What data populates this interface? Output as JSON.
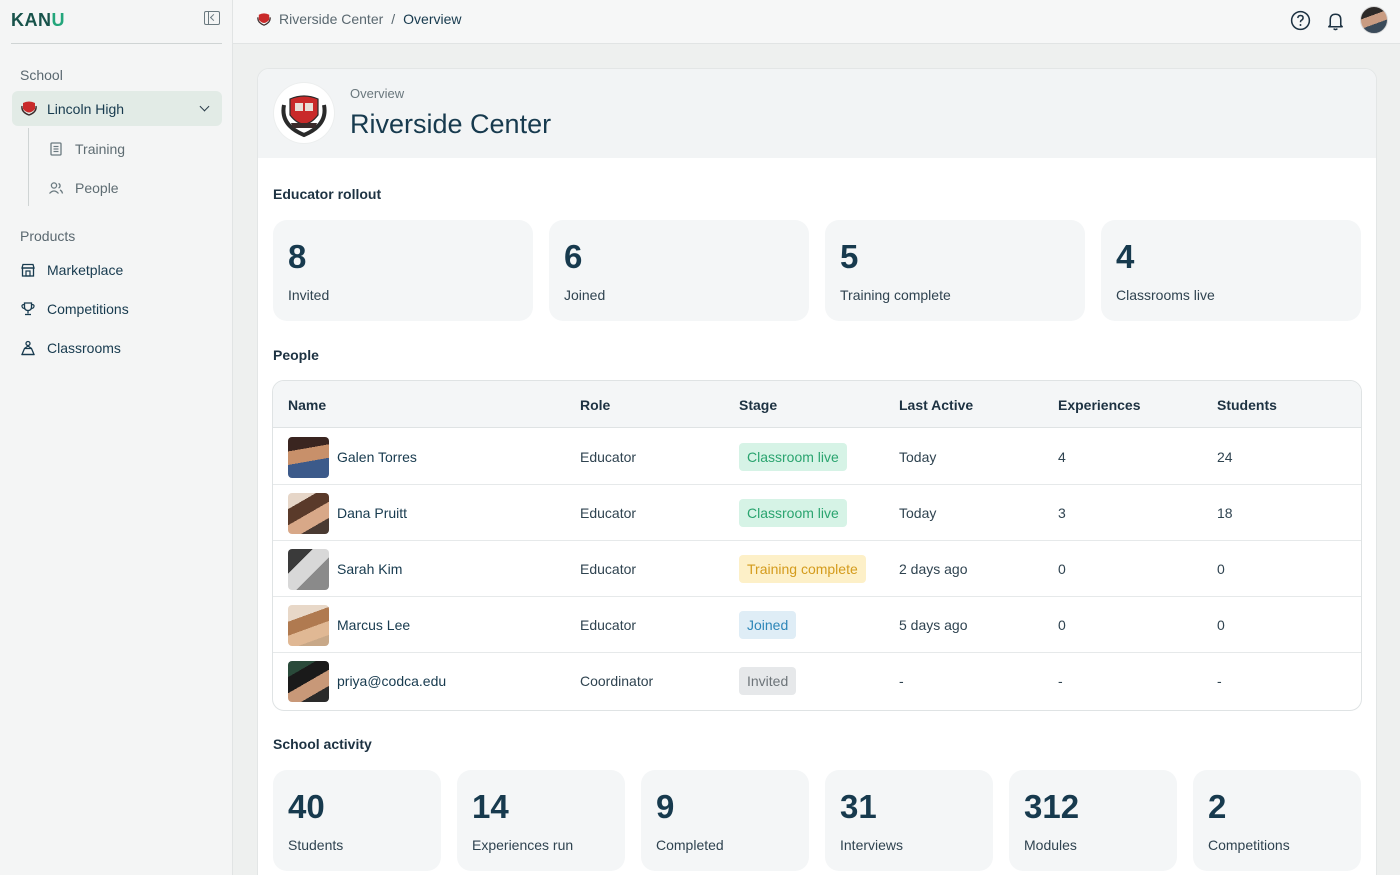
{
  "app": {
    "logo_k": "KAN",
    "logo_u": "U"
  },
  "sidebar": {
    "school_label": "School",
    "school_name": "Lincoln High",
    "sub_items": [
      "Training",
      "People"
    ],
    "products_label": "Products",
    "products": [
      "Marketplace",
      "Competitions",
      "Classrooms"
    ]
  },
  "topbar": {
    "breadcrumb_root": "Riverside Center",
    "breadcrumb_sep": "/",
    "breadcrumb_current": "Overview"
  },
  "header": {
    "subtitle": "Overview",
    "title": "Riverside Center"
  },
  "rollout": {
    "title": "Educator rollout",
    "stats": [
      {
        "value": "8",
        "label": "Invited"
      },
      {
        "value": "6",
        "label": "Joined"
      },
      {
        "value": "5",
        "label": "Training complete"
      },
      {
        "value": "4",
        "label": "Classrooms live"
      }
    ]
  },
  "people": {
    "title": "People",
    "columns": [
      "Name",
      "Role",
      "Stage",
      "Last Active",
      "Experiences",
      "Students"
    ],
    "rows": [
      {
        "name": "Galen Torres",
        "role": "Educator",
        "stage": "Classroom live",
        "last_active": "Today",
        "experiences": "4",
        "students": "24"
      },
      {
        "name": "Dana Pruitt",
        "role": "Educator",
        "stage": "Classroom live",
        "last_active": "Today",
        "experiences": "3",
        "students": "18"
      },
      {
        "name": "Sarah Kim",
        "role": "Educator",
        "stage": "Training complete",
        "last_active": "2 days ago",
        "experiences": "0",
        "students": "0"
      },
      {
        "name": "Marcus Lee",
        "role": "Educator",
        "stage": "Joined",
        "last_active": "5 days ago",
        "experiences": "0",
        "students": "0"
      },
      {
        "name": "priya@codca.edu",
        "role": "Coordinator",
        "stage": "Invited",
        "last_active": "-",
        "experiences": "-",
        "students": "-"
      }
    ]
  },
  "activity": {
    "title": "School activity",
    "stats": [
      {
        "value": "40",
        "label": "Students"
      },
      {
        "value": "14",
        "label": "Experiences run"
      },
      {
        "value": "9",
        "label": "Completed"
      },
      {
        "value": "31",
        "label": "Interviews"
      },
      {
        "value": "312",
        "label": "Modules"
      },
      {
        "value": "2",
        "label": "Competitions"
      }
    ]
  },
  "colors": {
    "brand": "#17524a",
    "accent": "#23a67b",
    "stage_live": "#2aa46f",
    "stage_training": "#d49b1c",
    "stage_joined": "#2d86b8",
    "stage_invited": "#6d7479"
  }
}
